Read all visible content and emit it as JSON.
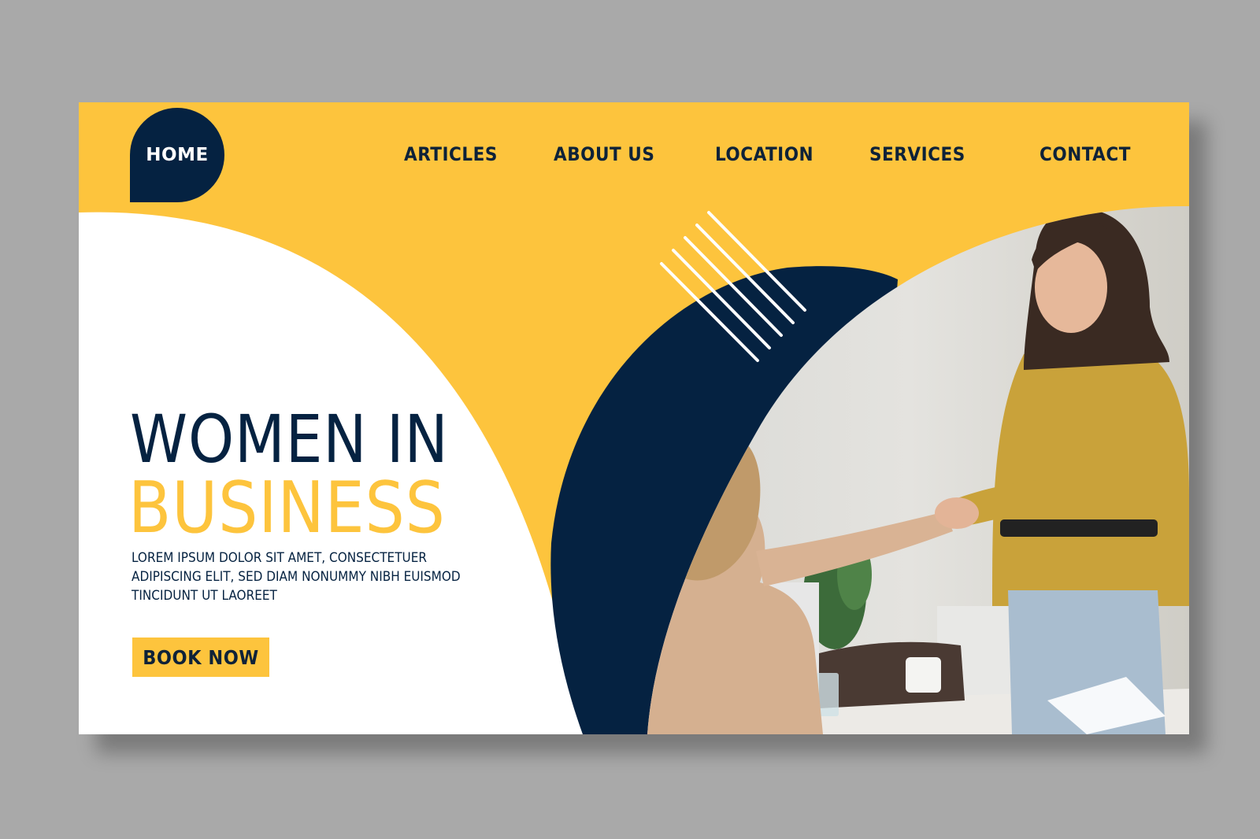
{
  "nav": {
    "home": "HOME",
    "items": [
      "ARTICLES",
      "ABOUT US",
      "LOCATION",
      "SERVICES",
      "CONTACT"
    ]
  },
  "hero": {
    "title_line1": "WOMEN IN",
    "title_line2": "BUSINESS",
    "body": "LOREM IPSUM DOLOR SIT AMET, CONSECTETUER ADIPISCING ELIT, SED DIAM NONUMMY NIBH EUISMOD TINCIDUNT UT LAOREET",
    "cta": "BOOK NOW"
  },
  "colors": {
    "yellow": "#fdc43d",
    "navy": "#052241",
    "white": "#ffffff",
    "backdrop": "#a9a9a9"
  },
  "image": {
    "icon": "business-handshake-photo"
  }
}
